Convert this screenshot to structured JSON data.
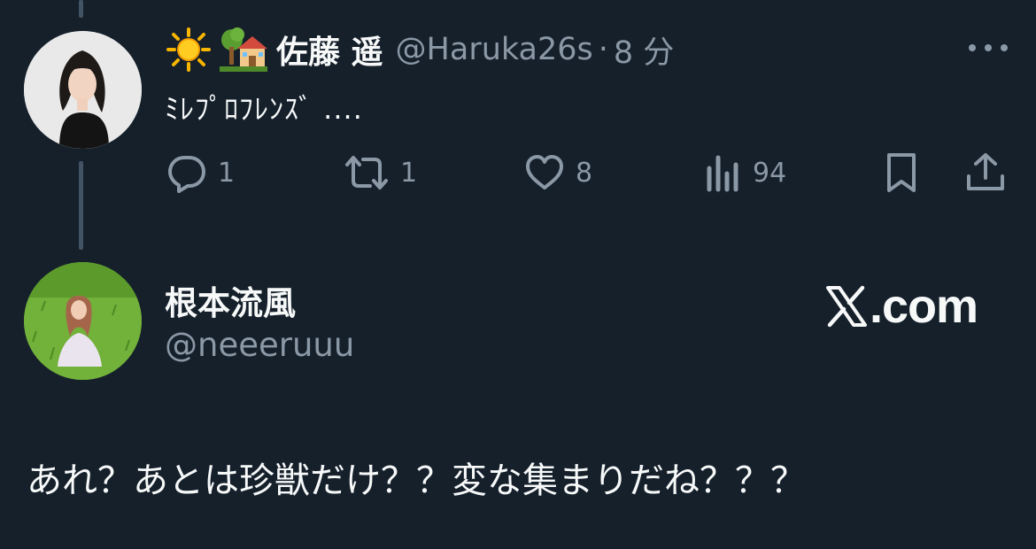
{
  "post1": {
    "emoji_1": "sun-emoji",
    "emoji_2": "house-with-garden-emoji",
    "display_name": "佐藤 遥",
    "handle": "@Haruka26s",
    "separator": "·",
    "time": "8 分",
    "text": "ﾐﾚﾌﾟﾛﾌﾚﾝｽﾞ ....",
    "actions": {
      "reply_count": "1",
      "repost_count": "1",
      "like_count": "8",
      "views_count": "94"
    }
  },
  "post2": {
    "display_name": "根本流風",
    "handle": "@neeeruuu",
    "brand": ".com",
    "text": "あれ？あとは珍獣だけ？？変な集まりだね？？？"
  },
  "colors": {
    "background": "#15202b",
    "text_primary": "#f7f9f9",
    "text_secondary": "#8b98a5",
    "thread_line": "#425364"
  }
}
